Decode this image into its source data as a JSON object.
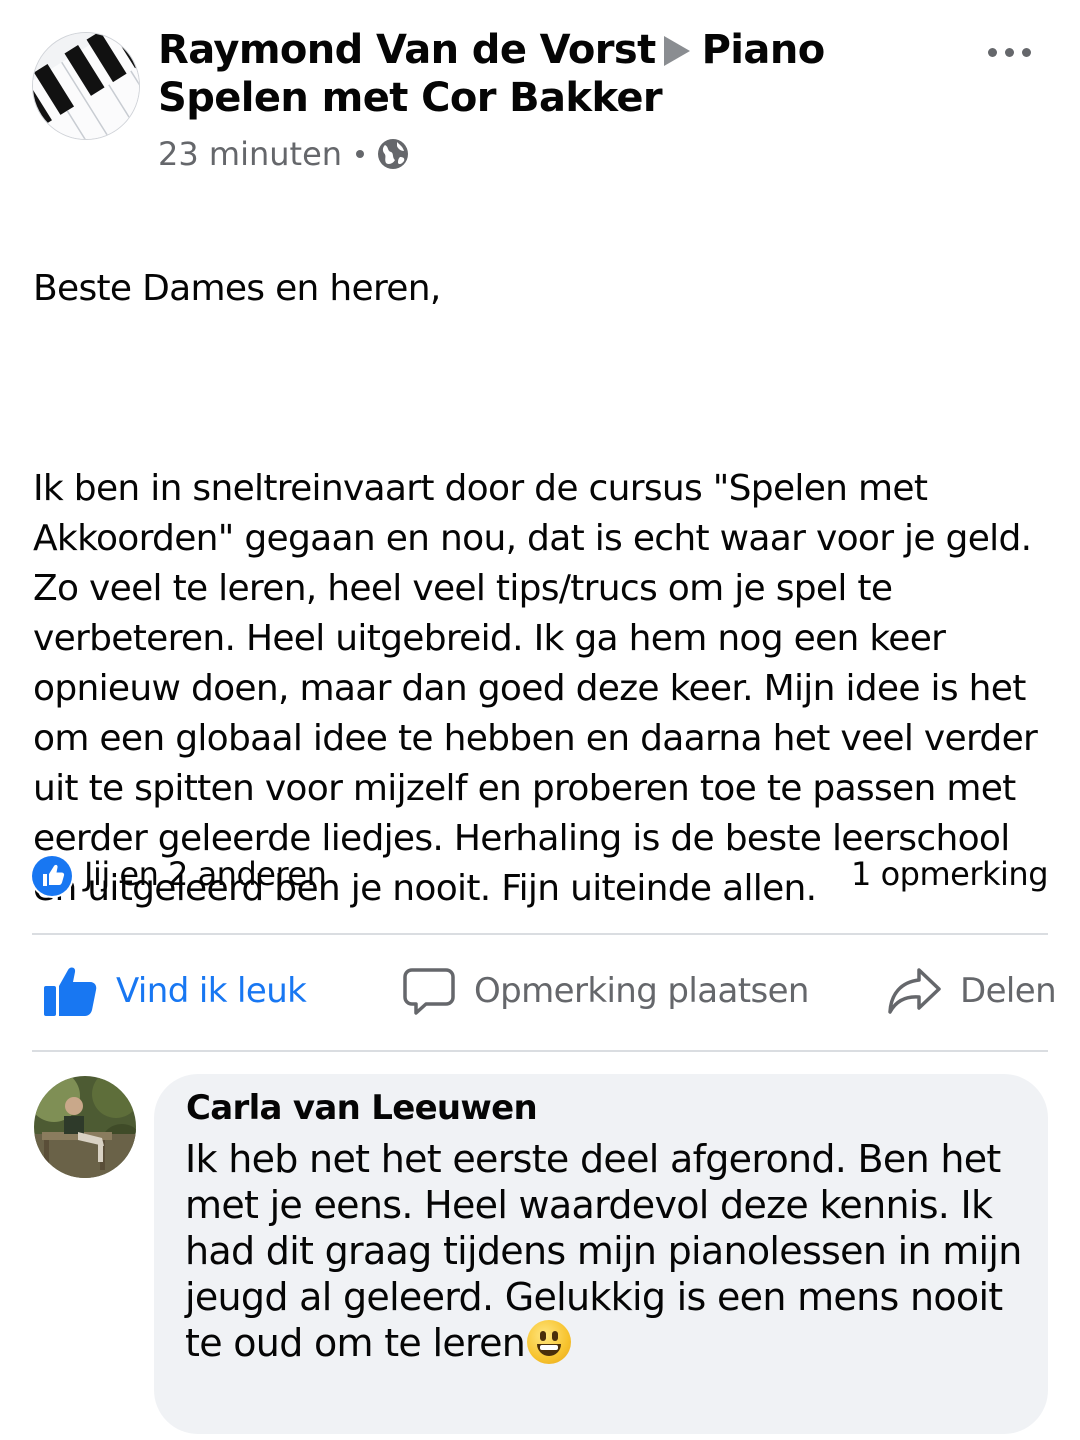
{
  "post": {
    "author": "Raymond Van de Vorst",
    "group": "Piano Spelen met Cor Bakker",
    "time": "23 minuten",
    "privacy_icon": "globe-icon",
    "greeting": "Beste Dames en heren,",
    "body": "Ik ben in sneltreinvaart door de cursus \"Spelen met Akkoorden\" gegaan en nou, dat is echt waar voor je geld. Zo veel te leren, heel veel tips/trucs om je spel te verbeteren. Heel uitgebreid. Ik ga hem nog een keer opnieuw doen, maar dan goed deze keer. Mijn idee is het om een globaal idee te hebben en daarna het veel verder uit te spitten voor mijzelf en proberen toe te passen met eerder geleerde liedjes. Herhaling is de beste leerschool en uitgeleerd ben je nooit. Fijn uiteinde allen.",
    "reactions": "Jij en 2 anderen",
    "comments_count": "1 opmerking"
  },
  "actions": {
    "like": "Vind ik leuk",
    "comment": "Opmerking plaatsen",
    "share": "Delen"
  },
  "comment": {
    "author": "Carla van Leeuwen",
    "text": "Ik heb net het eerste deel afgerond. Ben het met je eens. Heel waardevol deze kennis. Ik had dit graag tijdens mijn pianolessen in mijn jeugd al geleerd. Gelukkig is een mens nooit te oud om te leren",
    "emoji": "grinning-face-emoji"
  },
  "colors": {
    "accent": "#1877f2",
    "secondary_text": "#65676b",
    "bubble": "#f0f2f5"
  }
}
